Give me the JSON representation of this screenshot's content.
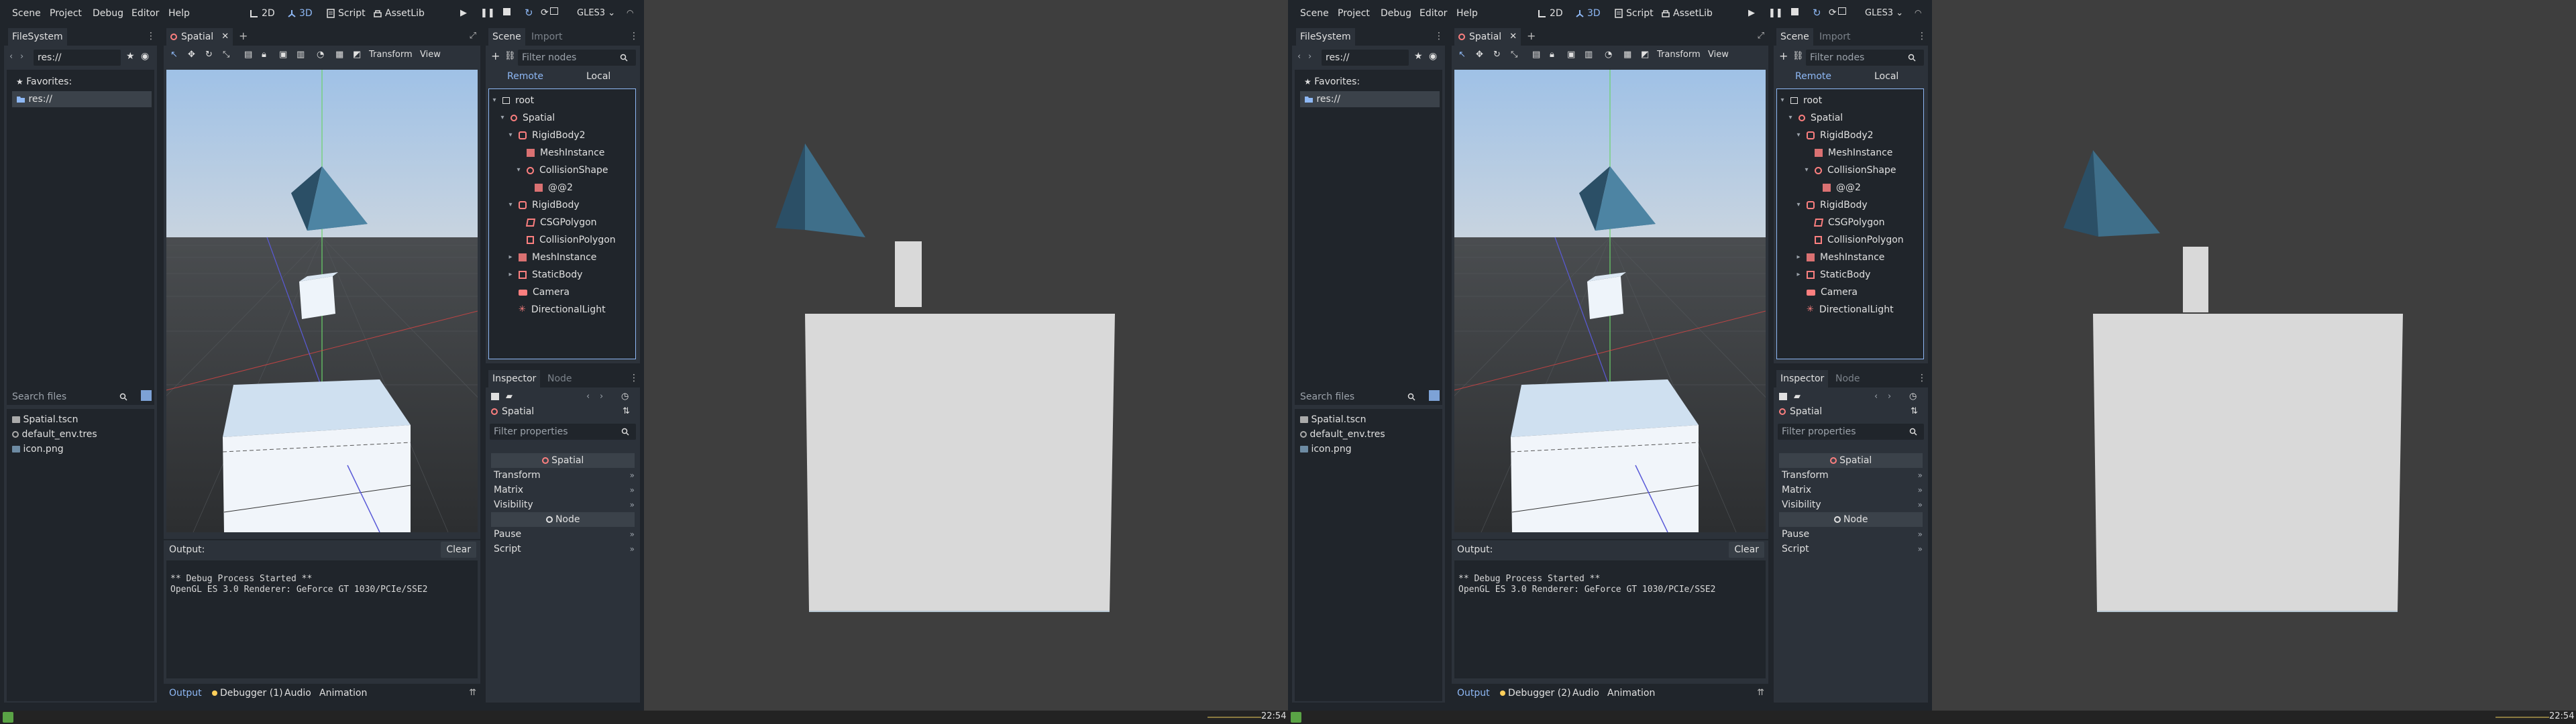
{
  "menus": [
    "Scene",
    "Project",
    "Debug",
    "Editor",
    "Help"
  ],
  "modes": [
    {
      "label": "2D",
      "icon": "2d-mode-icon",
      "active": false
    },
    {
      "label": "3D",
      "icon": "3d-mode-icon",
      "active": true
    },
    {
      "label": "Script",
      "icon": "script-icon",
      "active": false
    },
    {
      "label": "AssetLib",
      "icon": "assetlib-icon",
      "active": false
    }
  ],
  "renderer": "GLES3",
  "filesystem": {
    "tab": "FileSystem",
    "path": "res://",
    "favorites_label": "Favorites:",
    "tree_root": "res://",
    "search_placeholder": "Search files",
    "files": [
      {
        "name": "Spatial.tscn",
        "icon": "scene-file-icon"
      },
      {
        "name": "default_env.tres",
        "icon": "resource-file-icon"
      },
      {
        "name": "icon.png",
        "icon": "image-file-icon"
      }
    ]
  },
  "viewport": {
    "tab": "Spatial",
    "transform_menu": "Transform",
    "view_menu": "View"
  },
  "scene": {
    "tab_active": "Scene",
    "tab_inactive": "Import",
    "filter_placeholder": "Filter nodes",
    "remote": "Remote",
    "local": "Local",
    "nodes": [
      {
        "label": "root",
        "depth": 0,
        "icon": "root-node-icon",
        "arrow": "▾"
      },
      {
        "label": "Spatial",
        "depth": 1,
        "icon": "spatial-node-icon",
        "arrow": "▾"
      },
      {
        "label": "RigidBody2",
        "depth": 2,
        "icon": "rigidbody-icon",
        "arrow": "▾"
      },
      {
        "label": "MeshInstance",
        "depth": 3,
        "icon": "mesh-instance-icon",
        "arrow": ""
      },
      {
        "label": "CollisionShape",
        "depth": 3,
        "icon": "collision-shape-icon",
        "arrow": "▾"
      },
      {
        "label": "@@2",
        "depth": 4,
        "icon": "mesh-instance-icon",
        "arrow": ""
      },
      {
        "label": "RigidBody",
        "depth": 2,
        "icon": "rigidbody-icon",
        "arrow": "▾"
      },
      {
        "label": "CSGPolygon",
        "depth": 3,
        "icon": "csg-polygon-icon",
        "arrow": ""
      },
      {
        "label": "CollisionPolygon",
        "depth": 3,
        "icon": "collision-polygon-icon",
        "arrow": ""
      },
      {
        "label": "MeshInstance",
        "depth": 2,
        "icon": "mesh-instance-icon",
        "arrow": "▸"
      },
      {
        "label": "StaticBody",
        "depth": 2,
        "icon": "static-body-icon",
        "arrow": "▸"
      },
      {
        "label": "Camera",
        "depth": 2,
        "icon": "camera-icon",
        "arrow": ""
      },
      {
        "label": "DirectionalLight",
        "depth": 2,
        "icon": "directional-light-icon",
        "arrow": ""
      }
    ]
  },
  "inspector": {
    "tab_active": "Inspector",
    "tab_inactive": "Node",
    "object": "Spatial",
    "filter_placeholder": "Filter properties",
    "sections": [
      {
        "title": "Spatial",
        "props": [
          "Transform",
          "Matrix",
          "Visibility"
        ]
      },
      {
        "title": "Node",
        "props": [
          "Pause",
          "Script"
        ]
      }
    ]
  },
  "output": {
    "label": "Output:",
    "clear": "Clear",
    "lines": [
      "** Debug Process Started **",
      "OpenGL ES 3.0 Renderer: GeForce GT 1030/PCIe/SSE2"
    ]
  },
  "bottom_tabs": {
    "output": "Output",
    "audio": "Audio",
    "animation": "Animation"
  },
  "monitors": [
    {
      "debugger": "Debugger (1)",
      "clock": "22:54"
    },
    {
      "debugger": "Debugger (2)",
      "clock": "22:54"
    }
  ]
}
